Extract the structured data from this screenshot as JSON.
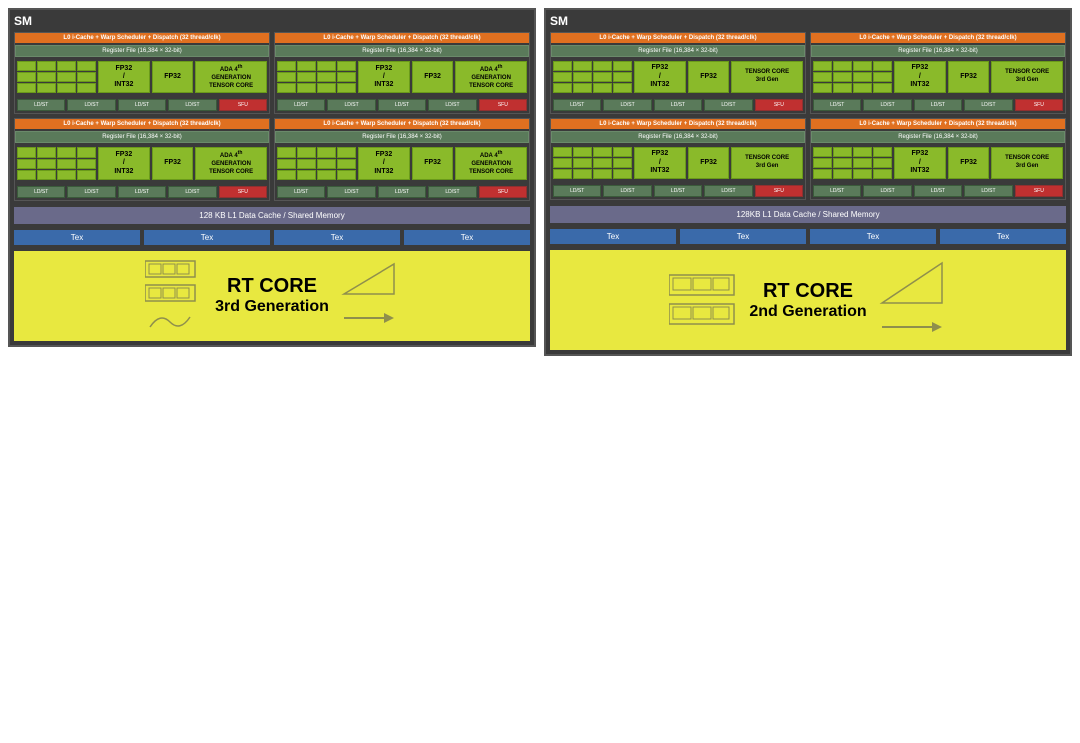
{
  "left_sm": {
    "label": "SM",
    "l1_cache": "128 KB L1 Data Cache / Shared Memory",
    "tex_units": [
      "Tex",
      "Tex",
      "Tex",
      "Tex"
    ],
    "rt_core_title": "RT CORE",
    "rt_core_subtitle": "3rd Generation",
    "warp_header": "L0 i-Cache + Warp Scheduler + Dispatch (32 thread/clk)",
    "reg_file": "Register File (16,384 × 32-bit)",
    "fp32_int32_label": "FP32 / INT32",
    "fp32_label": "FP32",
    "tensor_label": "ADA 4th GENERATION TENSOR CORE",
    "ldst_labels": [
      "LD/ST",
      "LD/ST",
      "LD/ST",
      "LD/ST"
    ],
    "sfu_label": "SFU"
  },
  "right_sm": {
    "label": "SM",
    "l1_cache": "128KB L1 Data Cache / Shared Memory",
    "tex_units": [
      "Tex",
      "Tex",
      "Tex",
      "Tex"
    ],
    "rt_core_title": "RT CORE",
    "rt_core_subtitle": "2nd Generation",
    "warp_header": "L0 i-Cache + Warp Scheduler + Dispatch (32 thread/clk)",
    "reg_file": "Register File (16,384 × 32-bit)",
    "fp32_int32_label": "FP32 / INT32",
    "fp32_label": "FP32",
    "tensor_label": "TENSOR CORE 3rd Gen",
    "ldst_labels": [
      "LD/ST",
      "LD/ST",
      "LD/ST",
      "LD/ST"
    ],
    "sfu_label": "SFU"
  }
}
